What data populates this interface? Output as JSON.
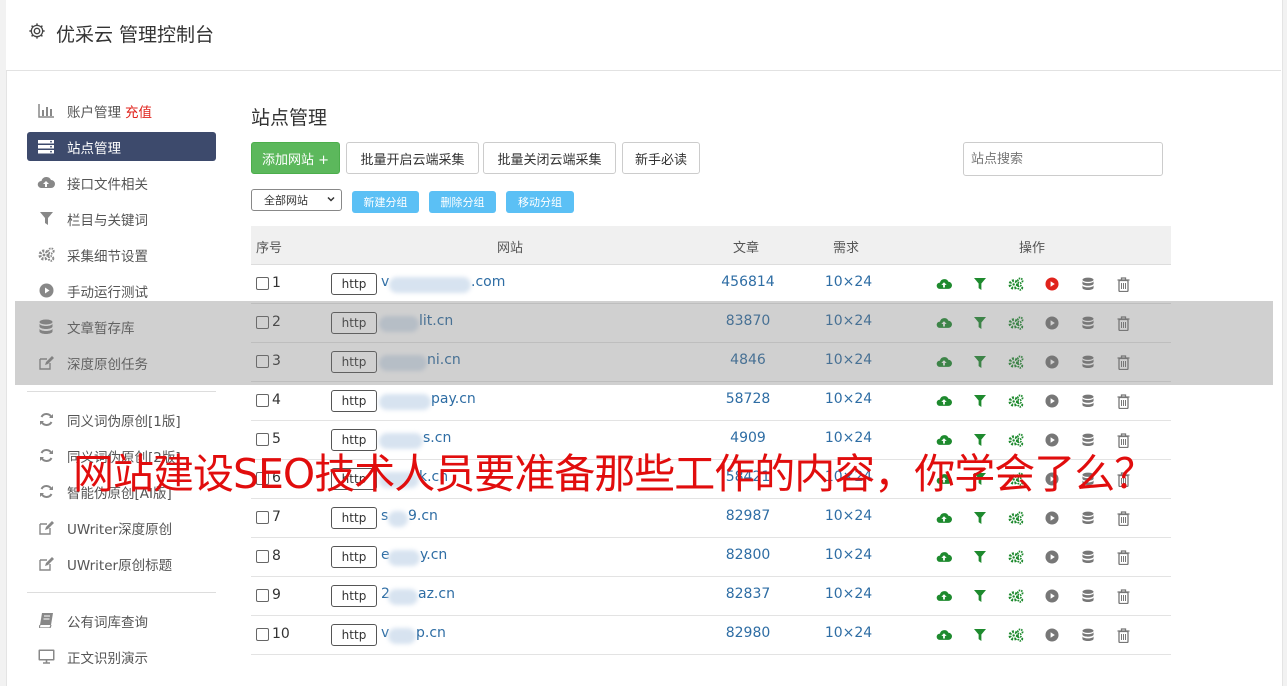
{
  "app": {
    "title": "优采云 管理控制台"
  },
  "sidebar": {
    "items": [
      {
        "label": "账户管理",
        "badge": "充值",
        "icon": "bar-chart-icon"
      },
      {
        "label": "站点管理",
        "icon": "server-list-icon",
        "active": true
      },
      {
        "label": "接口文件相关",
        "icon": "cloud-upload-icon"
      },
      {
        "label": "栏目与关键词",
        "icon": "filter-icon"
      },
      {
        "label": "采集细节设置",
        "icon": "cogs-icon"
      },
      {
        "label": "手动运行测试",
        "icon": "play-circle-icon"
      },
      {
        "label": "文章暂存库",
        "icon": "database-icon"
      },
      {
        "label": "深度原创任务",
        "icon": "edit-icon"
      },
      {
        "label": "同义词伪原创[1版]",
        "icon": "refresh-icon"
      },
      {
        "label": "同义词伪原创[2版]",
        "icon": "refresh-icon"
      },
      {
        "label": "智能伪原创[AI版]",
        "icon": "refresh-icon"
      },
      {
        "label": "UWriter深度原创",
        "icon": "edit-icon"
      },
      {
        "label": "UWriter原创标题",
        "icon": "edit-icon"
      },
      {
        "label": "公有词库查询",
        "icon": "book-icon"
      },
      {
        "label": "正文识别演示",
        "icon": "monitor-icon"
      }
    ]
  },
  "main": {
    "title": "站点管理",
    "buttons": {
      "add": "添加网站 +",
      "batch_on": "批量开启云端采集",
      "batch_off": "批量关闭云端采集",
      "guide": "新手必读"
    },
    "search_placeholder": "站点搜索",
    "group_select": "全部网站",
    "group_buttons": {
      "new": "新建分组",
      "delete": "删除分组",
      "move": "移动分组"
    },
    "table": {
      "headers": {
        "seq": "序号",
        "site": "网站",
        "articles": "文章",
        "demand": "需求",
        "actions": "操作"
      },
      "rows": [
        {
          "seq": "1",
          "protocol": "http",
          "site_prefix": "v",
          "site_suffix": ".com",
          "articles": "456814",
          "demand": "10×24",
          "run_active": true
        },
        {
          "seq": "2",
          "protocol": "http",
          "site_prefix": "",
          "site_suffix": "lit.cn",
          "articles": "83870",
          "demand": "10×24"
        },
        {
          "seq": "3",
          "protocol": "http",
          "site_prefix": "",
          "site_suffix": "ni.cn",
          "articles": "4846",
          "demand": "10×24"
        },
        {
          "seq": "4",
          "protocol": "http",
          "site_prefix": "",
          "site_suffix": "pay.cn",
          "articles": "58728",
          "demand": "10×24"
        },
        {
          "seq": "5",
          "protocol": "http",
          "site_prefix": "",
          "site_suffix": "s.cn",
          "articles": "4909",
          "demand": "10×24"
        },
        {
          "seq": "6",
          "protocol": "http",
          "site_prefix": "",
          "site_suffix": "k.cn",
          "articles": "58421",
          "demand": "10×24"
        },
        {
          "seq": "7",
          "protocol": "http",
          "site_prefix": "s",
          "site_suffix": "9.cn",
          "articles": "82987",
          "demand": "10×24"
        },
        {
          "seq": "8",
          "protocol": "http",
          "site_prefix": "e",
          "site_suffix": "y.cn",
          "articles": "82800",
          "demand": "10×24"
        },
        {
          "seq": "9",
          "protocol": "http",
          "site_prefix": "2",
          "site_suffix": "az.cn",
          "articles": "82837",
          "demand": "10×24"
        },
        {
          "seq": "10",
          "protocol": "http",
          "site_prefix": "v",
          "site_suffix": "p.cn",
          "articles": "82980",
          "demand": "10×24"
        }
      ]
    }
  },
  "overlay_caption": "网站建设SEO技术人员要准备那些工作的内容，你学会了么？",
  "colors": {
    "accent_green": "#5cb85c",
    "sidebar_active": "#3d4a6c",
    "link_blue": "#2e6da4",
    "caption_red": "#e10d0d",
    "run_red": "#e0231c"
  }
}
